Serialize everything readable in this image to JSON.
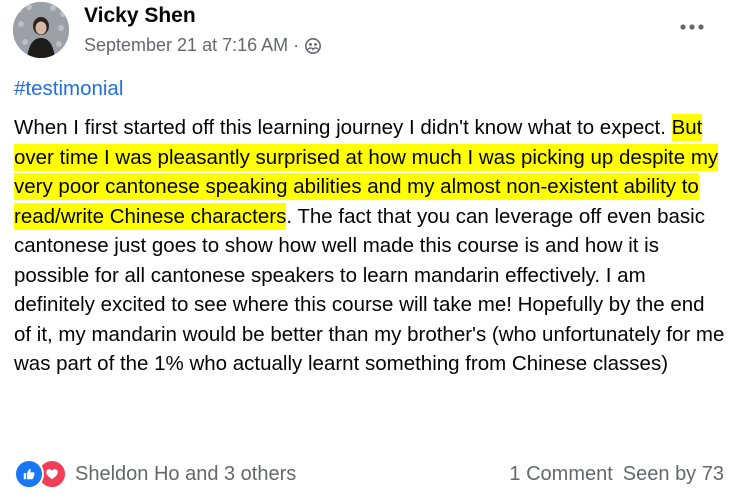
{
  "post": {
    "author": "Vicky Shen",
    "timestamp": "September 21 at 7:16 AM",
    "separator": "·",
    "privacy_icon": "friends-icon",
    "more_icon": "more-options-icon",
    "hashtag": "#testimonial",
    "text_part1": "When I first started off this learning journey I didn't know what to expect. ",
    "text_highlighted": "But over time I was pleasantly surprised at how much I was picking up despite my very poor cantonese speaking abilities and my almost non-existent ability to read/write Chinese characters",
    "text_part2": ". The fact that you can leverage off even basic cantonese just goes to show how well made this course is and how it is possible for all cantonese speakers to learn mandarin effectively. I am definitely excited to see where this course will take me! Hopefully by the end of it, my mandarin would be better than my brother's (who unfortunately for me was part of the 1% who actually learnt something from Chinese classes)"
  },
  "footer": {
    "reaction_icons": [
      "like-icon",
      "love-icon"
    ],
    "reactors": "Sheldon Ho and 3 others",
    "comments": "1 Comment",
    "seen_by": "Seen by 73"
  },
  "colors": {
    "highlight": "#ffff00",
    "link": "#216fdb",
    "secondary_text": "#65676b",
    "like": "#1877f2",
    "love": "#f33e58"
  }
}
